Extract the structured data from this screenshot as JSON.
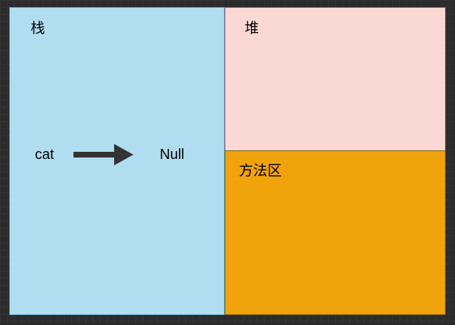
{
  "diagram": {
    "stack": {
      "label": "栈",
      "variable": "cat",
      "reference": "Null"
    },
    "heap": {
      "label": "堆"
    },
    "method_area": {
      "label": "方法区"
    }
  },
  "colors": {
    "stack_fill": "#b1ddf0",
    "heap_fill": "#fad9d5",
    "method_area_fill": "#f0a30a",
    "arrow": "#333333",
    "canvas_background": "#2b2b2b"
  },
  "icons": {
    "pointer_arrow": "arrow-right-icon"
  }
}
